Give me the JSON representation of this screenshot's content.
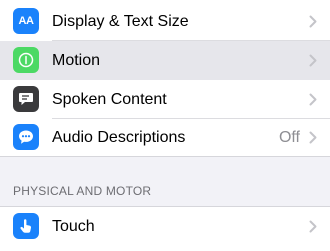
{
  "settings": {
    "rows": [
      {
        "label": "Display & Text Size",
        "icon": "text-size-icon",
        "icon_glyph": "AA",
        "value": ""
      },
      {
        "label": "Motion",
        "icon": "motion-icon",
        "icon_glyph": "",
        "value": ""
      },
      {
        "label": "Spoken Content",
        "icon": "speech-bubble-icon",
        "icon_glyph": "",
        "value": ""
      },
      {
        "label": "Audio Descriptions",
        "icon": "audio-description-icon",
        "icon_glyph": "",
        "value": "Off"
      }
    ],
    "section_header": "PHYSICAL AND MOTOR",
    "section_rows": [
      {
        "label": "Touch",
        "icon": "touch-hand-icon",
        "value": ""
      }
    ]
  },
  "colors": {
    "blue": "#1a82fb",
    "green": "#4cd964",
    "dark": "#3a3a3c",
    "background": "#f2f2f7",
    "secondary_text": "#8e8e93"
  }
}
